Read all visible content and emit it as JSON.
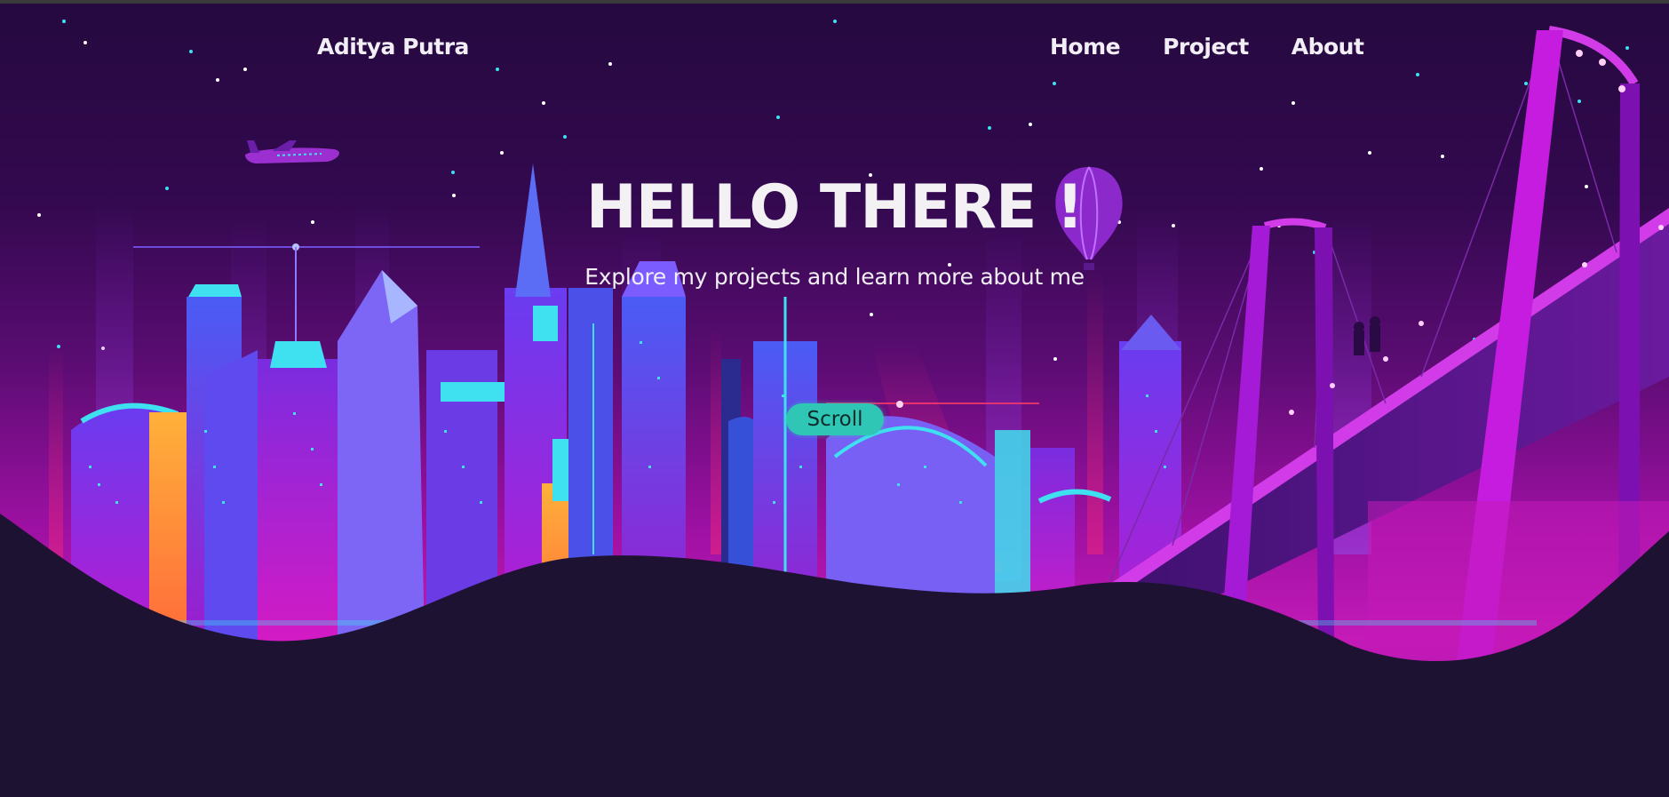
{
  "nav": {
    "brand": "Aditya Putra",
    "links": [
      "Home",
      "Project",
      "About"
    ]
  },
  "hero": {
    "title": "HELLO THERE !",
    "subtitle": "Explore my projects and learn more about me",
    "scroll_label": "Scroll"
  },
  "colors": {
    "sky_top": "#2a0a45",
    "sky_mid": "#7a0e8a",
    "neon_cyan": "#3fe0f0",
    "neon_magenta": "#e023d9",
    "ground": "#1e1233",
    "scroll_button": "#2fc6b5"
  }
}
